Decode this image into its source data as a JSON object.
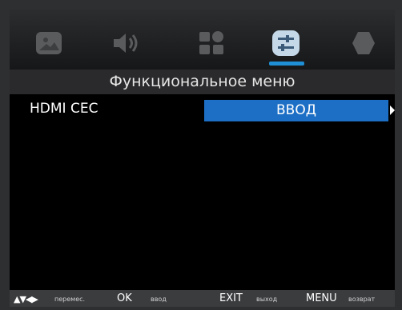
{
  "tabs": [
    {
      "icon": "picture-icon"
    },
    {
      "icon": "sound-icon"
    },
    {
      "icon": "apps-icon"
    },
    {
      "icon": "settings-icon",
      "active": true
    },
    {
      "icon": "lock-icon"
    }
  ],
  "menu": {
    "title": "Функциональное меню",
    "row": {
      "label": "HDMI CEC",
      "value": "ВВОД"
    }
  },
  "hints": {
    "nav_symbols": "▲▼◀▶",
    "nav_label": "перемес.",
    "ok_key": "OK",
    "ok_label": "ввод",
    "exit_key": "EXIT",
    "exit_label": "выход",
    "menu_key": "MENU",
    "menu_label": "возврат"
  },
  "colors": {
    "accent": "#1d6fc5",
    "underline": "#1f8fd6",
    "icon_gray": "#5a5b5d"
  }
}
